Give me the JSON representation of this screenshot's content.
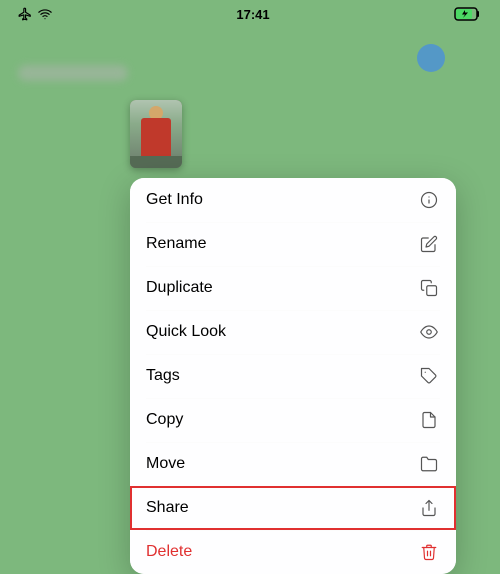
{
  "statusBar": {
    "time": "17:41",
    "batteryLevel": 75
  },
  "contextMenu": {
    "items": [
      {
        "id": "get-info",
        "label": "Get Info",
        "icon": "info"
      },
      {
        "id": "rename",
        "label": "Rename",
        "icon": "pencil"
      },
      {
        "id": "duplicate",
        "label": "Duplicate",
        "icon": "duplicate"
      },
      {
        "id": "quick-look",
        "label": "Quick Look",
        "icon": "eye"
      },
      {
        "id": "tags",
        "label": "Tags",
        "icon": "tag"
      },
      {
        "id": "copy",
        "label": "Copy",
        "icon": "copy"
      },
      {
        "id": "move",
        "label": "Move",
        "icon": "folder"
      },
      {
        "id": "share",
        "label": "Share",
        "icon": "share",
        "highlighted": true
      },
      {
        "id": "delete",
        "label": "Delete",
        "icon": "trash",
        "destructive": true
      }
    ]
  }
}
